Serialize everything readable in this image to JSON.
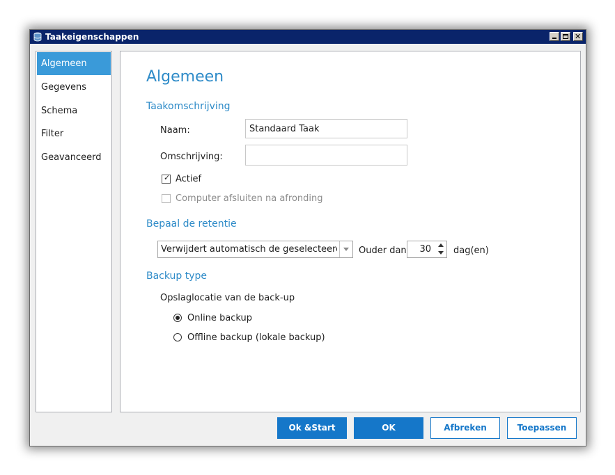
{
  "window": {
    "title": "Taakeigenschappen",
    "accent_color": "#0a246a"
  },
  "sidebar": {
    "items": [
      {
        "label": "Algemeen",
        "active": true
      },
      {
        "label": "Gegevens",
        "active": false
      },
      {
        "label": "Schema",
        "active": false
      },
      {
        "label": "Filter",
        "active": false
      },
      {
        "label": "Geavanceerd",
        "active": false
      }
    ],
    "active_color": "#3a9ad9"
  },
  "main": {
    "page_title": "Algemeen",
    "heading_color": "#2e8bc8",
    "task_description": {
      "title": "Taakomschrijving",
      "name_label": "Naam:",
      "name_value": "Standaard Taak",
      "description_label": "Omschrijving:",
      "description_value": "",
      "active_label": "Actief",
      "active_checked": true,
      "shutdown_label": "Computer afsluiten na afronding",
      "shutdown_checked": false,
      "shutdown_enabled": false
    },
    "retention": {
      "title": "Bepaal de retentie",
      "policy_selected": "Verwijdert automatisch de geselecteerde back-ups",
      "older_than_label": "Ouder dan",
      "days_value": "30",
      "days_unit": "dag(en)"
    },
    "backup_type": {
      "title": "Backup type",
      "location_label": "Opslaglocatie van de back-up",
      "options": [
        {
          "label": "Online backup",
          "selected": true
        },
        {
          "label": "Offline backup (lokale backup)",
          "selected": false
        }
      ]
    }
  },
  "footer": {
    "buttons": [
      {
        "label": "Ok &Start",
        "style": "primary"
      },
      {
        "label": "OK",
        "style": "primary"
      },
      {
        "label": "Afbreken",
        "style": "secondary"
      },
      {
        "label": "Toepassen",
        "style": "secondary"
      }
    ],
    "primary_color": "#1577c9"
  }
}
